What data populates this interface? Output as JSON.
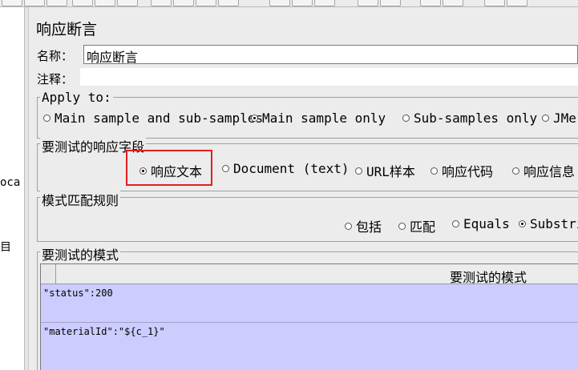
{
  "tree": {
    "fragment_1": "oca",
    "fragment_2": "目"
  },
  "panel": {
    "title": "响应断言",
    "name_label": "名称：",
    "name_value": "响应断言",
    "comment_label": "注释：",
    "comment_value": ""
  },
  "apply_to": {
    "title": "Apply to:",
    "options": [
      {
        "label": "Main sample and sub-samples",
        "selected": false
      },
      {
        "label": "Main sample only",
        "selected": true
      },
      {
        "label": "Sub-samples only",
        "selected": false
      },
      {
        "label": "JMe",
        "selected": false
      }
    ]
  },
  "field_to_test": {
    "title": "要测试的响应字段",
    "options": [
      {
        "label": "响应文本",
        "selected": true
      },
      {
        "label": "Document (text)",
        "selected": false
      },
      {
        "label": "URL样本",
        "selected": false
      },
      {
        "label": "响应代码",
        "selected": false
      },
      {
        "label": "响应信息",
        "selected": false
      }
    ]
  },
  "pattern_rules": {
    "title": "模式匹配规则",
    "options": [
      {
        "label": "包括",
        "selected": false
      },
      {
        "label": "匹配",
        "selected": false
      },
      {
        "label": "Equals",
        "selected": false
      },
      {
        "label": "Substri",
        "selected": true
      }
    ]
  },
  "patterns": {
    "title": "要测试的模式",
    "column_header": "要测试的模式",
    "rows": [
      "\"status\":200",
      "\"materialId\":\"${c_1}\""
    ]
  },
  "colors": {
    "highlight_box": "#e02020",
    "row_bg": "#ccccff",
    "panel_bg": "#ececec"
  }
}
